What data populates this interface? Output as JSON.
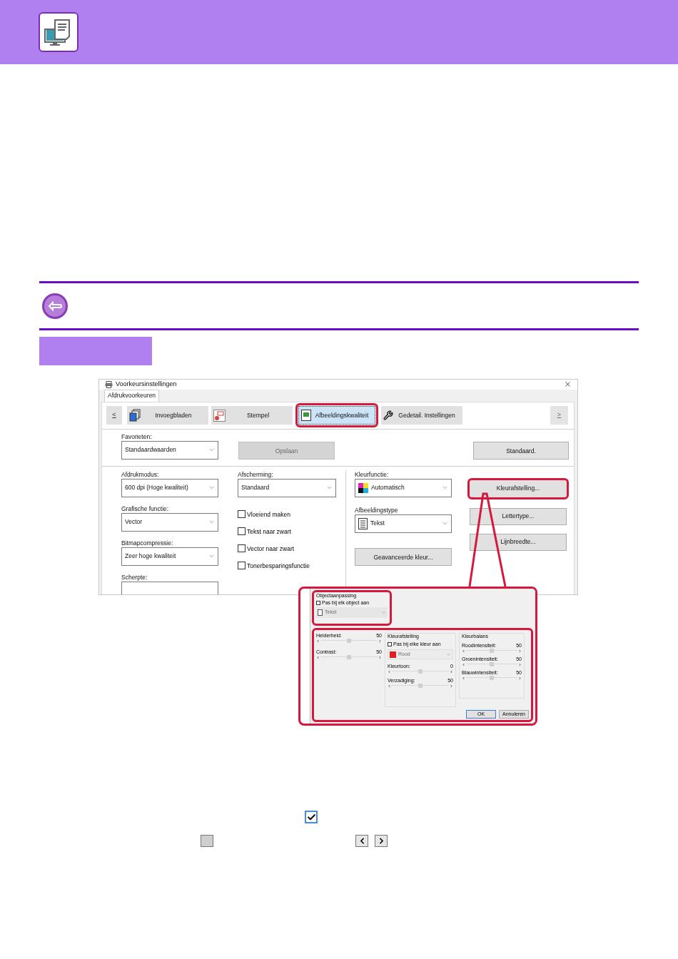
{
  "dialog": {
    "title": "Voorkeursinstellingen",
    "tabs": [
      {
        "label": "Afdrukvoorkeuren",
        "selected": true
      }
    ],
    "nav_prev": {
      "label": "<",
      "disabled": false
    },
    "nav_next": {
      "label": ">",
      "disabled": true
    },
    "sections": [
      {
        "kind": "pages",
        "label": "Invoegbladen",
        "selected": false,
        "highlighted": false
      },
      {
        "kind": "stamp",
        "label": "Stempel",
        "selected": false,
        "highlighted": false
      },
      {
        "kind": "image",
        "label": "Afbeeldingskwaliteit",
        "selected": true,
        "highlighted": true
      },
      {
        "kind": "wrench",
        "label": "Gedetail. Instellingen",
        "selected": false,
        "highlighted": false
      }
    ],
    "favorites": {
      "label": "Favorieten:",
      "value": "Standaardwaarden"
    },
    "save_button": {
      "label": "Opslaan",
      "disabled": true
    },
    "default_button": {
      "label": "Standaard.",
      "disabled": false
    },
    "column_1": [
      {
        "label": "Afdrukmodus:",
        "value": "600 dpi (Hoge kwaliteit)"
      },
      {
        "label": "Grafische functie:",
        "value": "Vector"
      },
      {
        "label": "Bitmapcompressie:",
        "value": "Zeer hoge kwaliteit"
      },
      {
        "label": "Scherpte:"
      }
    ],
    "screening": {
      "label": "Afscherming:",
      "value": "Standaard"
    },
    "checkboxes": [
      {
        "label": "Vloeiend maken",
        "checked": false
      },
      {
        "label": "Tekst naar zwart",
        "checked": false
      },
      {
        "label": "Vector naar zwart",
        "checked": false
      },
      {
        "label": "Tonerbesparingsfunctie",
        "checked": false
      }
    ],
    "color_mode": {
      "label": "Kleurfunctie:",
      "value": "Automatisch"
    },
    "image_type": {
      "label": "Afbeeldingstype",
      "value": "Tekst"
    },
    "advanced_color_button": {
      "label": "Geavanceerde kleur..."
    },
    "side_buttons": [
      {
        "label": "Kleurafstelling...",
        "highlighted": true
      },
      {
        "label": "Lettertype...",
        "highlighted": false
      },
      {
        "label": "Lijnbreedte...",
        "highlighted": false
      }
    ]
  },
  "popup": {
    "object_group": {
      "title": "Objectaanpassing",
      "checkbox": {
        "label": "Pas bij elk object aan",
        "checked": false
      },
      "select": {
        "value": "Tekst",
        "disabled": true
      }
    },
    "left_sliders": [
      {
        "label": "Helderheid:",
        "reading": "50",
        "level": 0.5
      },
      {
        "label": "Contrast:",
        "reading": "50",
        "level": 0.5
      }
    ],
    "color_adjust": {
      "title": "Kleurafstelling",
      "checkbox": {
        "label": "Pas bij elke kleur aan",
        "checked": false
      },
      "select": {
        "value": "Rood",
        "color": "#e02020",
        "disabled": true
      },
      "sliders": [
        {
          "label": "Kleurtoon:",
          "reading": "0",
          "level": 0.5
        },
        {
          "label": "Verzadiging:",
          "reading": "50",
          "level": 0.5
        }
      ]
    },
    "color_balance": {
      "title": "Kleurbalans",
      "sliders": [
        {
          "label": "Roodintensiteit:",
          "reading": "50",
          "level": 0.5
        },
        {
          "label": "Groenintensiteit:",
          "reading": "50",
          "level": 0.5
        },
        {
          "label": "Blauwintensiteit:",
          "reading": "50",
          "level": 0.5
        }
      ]
    },
    "buttons": [
      {
        "label": "OK",
        "default": true
      },
      {
        "label": "Annuleren",
        "default": false
      }
    ]
  },
  "legend_icons": [
    {
      "kind": "checkbox",
      "checked": true
    },
    {
      "kind": "square"
    },
    {
      "kind": "arrows"
    }
  ]
}
